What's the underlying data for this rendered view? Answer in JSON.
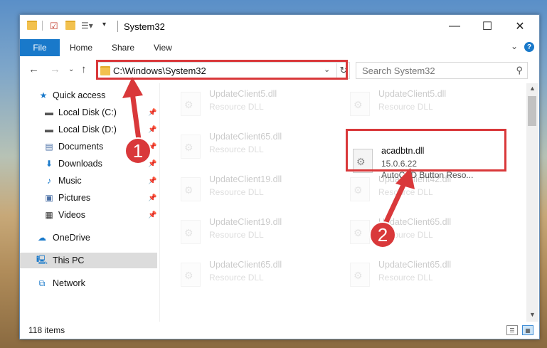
{
  "window": {
    "title": "System32",
    "controls": {
      "minimize": "—",
      "maximize": "☐",
      "close": "✕"
    }
  },
  "ribbon": {
    "tabs": [
      "File",
      "Home",
      "Share",
      "View"
    ],
    "help": "?",
    "collapse": "⌄"
  },
  "address": {
    "path": "C:\\Windows\\System32",
    "search_placeholder": "Search System32"
  },
  "sidebar": {
    "items": [
      {
        "label": "Quick access",
        "icon": "star-icon",
        "pinned": false
      },
      {
        "label": "Local Disk (C:)",
        "icon": "drive-icon",
        "pinned": true
      },
      {
        "label": "Local Disk (D:)",
        "icon": "drive-icon",
        "pinned": true
      },
      {
        "label": "Documents",
        "icon": "documents-icon",
        "pinned": true
      },
      {
        "label": "Downloads",
        "icon": "download-icon",
        "pinned": true
      },
      {
        "label": "Music",
        "icon": "music-icon",
        "pinned": true
      },
      {
        "label": "Pictures",
        "icon": "pictures-icon",
        "pinned": true
      },
      {
        "label": "Videos",
        "icon": "videos-icon",
        "pinned": true
      },
      {
        "label": "OneDrive",
        "icon": "cloud-icon",
        "pinned": false
      },
      {
        "label": "This PC",
        "icon": "computer-icon",
        "pinned": false,
        "selected": true
      },
      {
        "label": "Network",
        "icon": "network-icon",
        "pinned": false
      }
    ]
  },
  "files": {
    "left": [
      {
        "name": "UpdateClient5.dll",
        "type": "Resource DLL"
      },
      {
        "name": "UpdateClient65.dll",
        "type": "Resource DLL"
      },
      {
        "name": "UpdateClient19.dll",
        "type": "Resource DLL"
      },
      {
        "name": "UpdateClient19.dll",
        "type": "Resource DLL"
      },
      {
        "name": "UpdateClient65.dll",
        "type": "Resource DLL"
      }
    ],
    "right": [
      {
        "name": "UpdateClient5.dll",
        "type": "Resource DLL"
      },
      {
        "name": "acadbtn.dll",
        "version": "15.0.6.22",
        "type": "AutoCAD Button Reso..."
      },
      {
        "name": "UpdateClient42.dll",
        "type": "Resource DLL"
      },
      {
        "name": "UpdateClient65.dll",
        "type": "Resource DLL"
      },
      {
        "name": "UpdateClient65.dll",
        "type": "Resource DLL"
      }
    ]
  },
  "status": {
    "count": "118 items"
  },
  "annotations": {
    "step1": "1",
    "step2": "2",
    "color": "#d9383a"
  }
}
